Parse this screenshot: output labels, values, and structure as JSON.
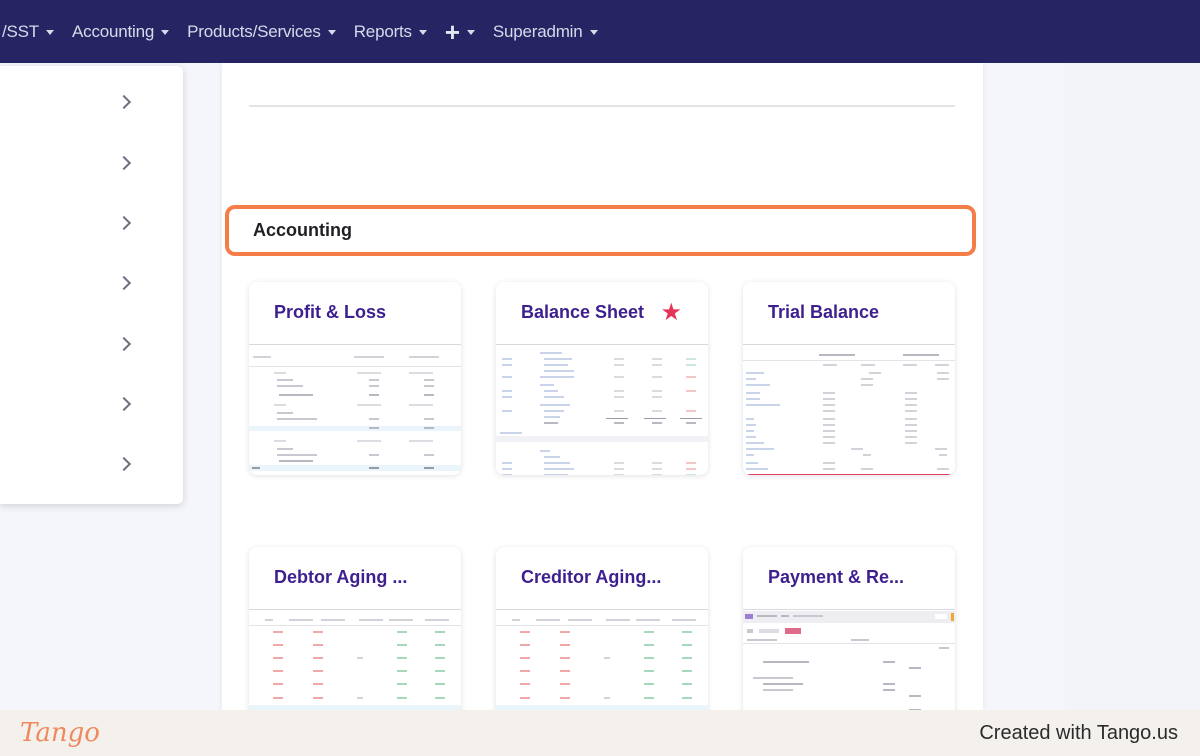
{
  "nav": {
    "items": [
      {
        "label": "/SST",
        "caret": true
      },
      {
        "label": "Accounting",
        "caret": true
      },
      {
        "label": "Products/Services",
        "caret": true
      },
      {
        "label": "Reports",
        "caret": true
      },
      {
        "label": "+",
        "caret": true
      },
      {
        "label": "Superadmin",
        "caret": true
      }
    ]
  },
  "section": {
    "title": "Accounting"
  },
  "cards": [
    {
      "title": "Profit & Loss",
      "favorite": false
    },
    {
      "title": "Balance Sheet",
      "favorite": true
    },
    {
      "title": "Trial Balance",
      "favorite": false
    },
    {
      "title": "Debtor Aging ...",
      "favorite": false
    },
    {
      "title": "Creditor Aging...",
      "favorite": false
    },
    {
      "title": "Payment & Re...",
      "favorite": false
    }
  ],
  "footer": {
    "logo": "Tango",
    "created": "Created with Tango.us"
  },
  "colors": {
    "nav_bg": "#262463",
    "highlight": "#f47d48",
    "card_title": "#3e1f8f",
    "star": "#e53457"
  },
  "icons": {
    "star": "star-icon",
    "chevron": "chevron-right-icon",
    "caret": "caret-down-icon"
  }
}
